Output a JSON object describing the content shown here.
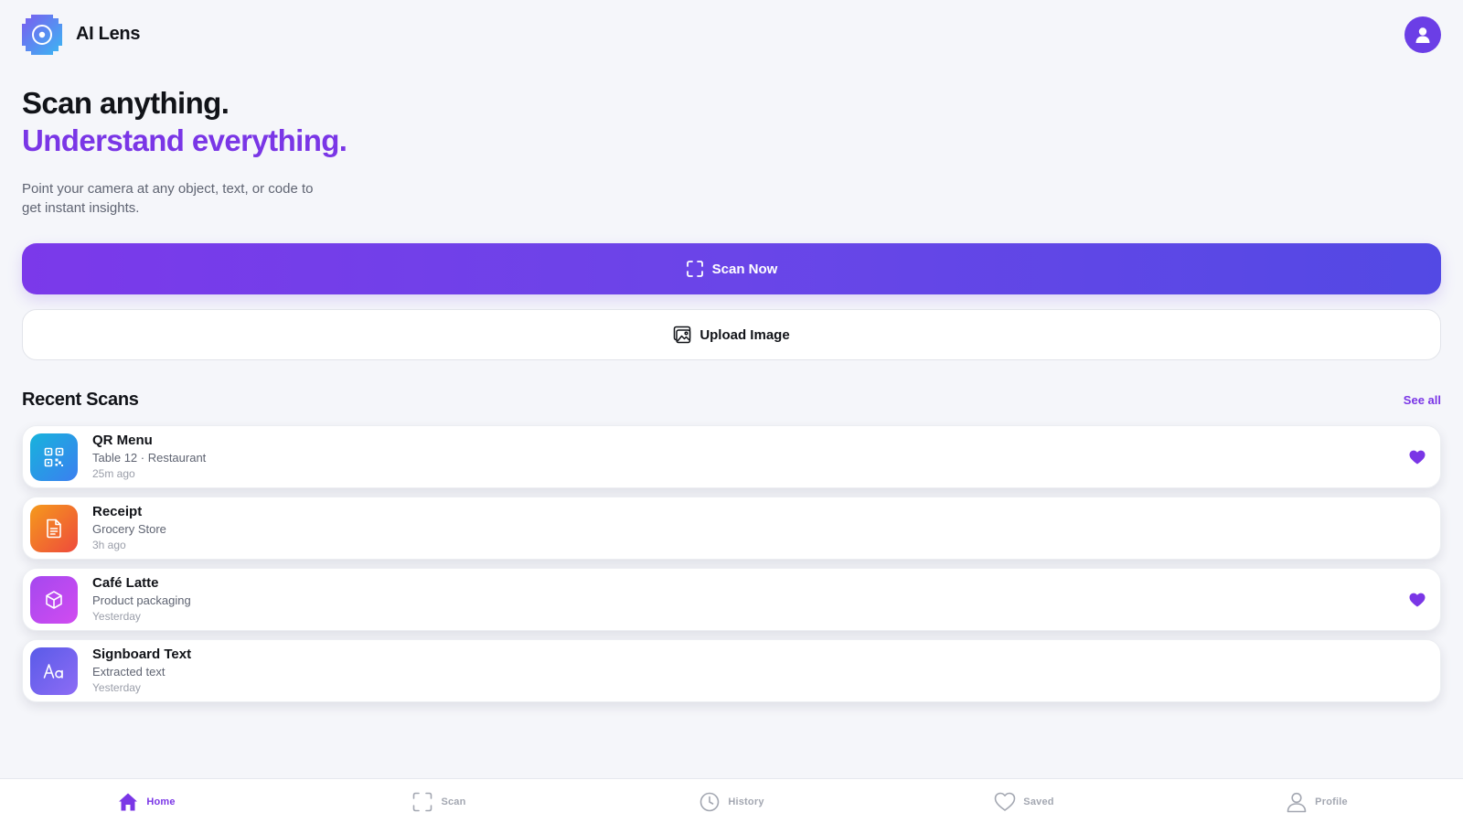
{
  "app": {
    "name": "AI Lens"
  },
  "colors": {
    "accent": "#7a36e6",
    "background": "#f5f6fa",
    "gradient_start": "#7b39ea",
    "gradient_end": "#5349e4"
  },
  "hero": {
    "headline": "Scan anything.",
    "headline_accent": "Understand everything.",
    "description": "Point your camera at any object, text, or code to get instant insights."
  },
  "actions": {
    "scan_label": "Scan Now",
    "scan_icon": "scan-frame-icon",
    "upload_label": "Upload Image",
    "upload_icon": "image-icon"
  },
  "recent": {
    "title": "Recent Scans",
    "see_all_label": "See all",
    "items": [
      {
        "title": "QR Menu",
        "subtitle": "Table 12 · Restaurant",
        "time": "25m ago",
        "icon": "qr-code-icon",
        "favorited": true,
        "color_from": "#17b3dc",
        "color_to": "#3b7ff0"
      },
      {
        "title": "Receipt",
        "subtitle": "Grocery Store",
        "time": "3h ago",
        "icon": "document-icon",
        "favorited": false,
        "color_from": "#f59a1c",
        "color_to": "#ee4a3c"
      },
      {
        "title": "Café Latte",
        "subtitle": "Product packaging",
        "time": "Yesterday",
        "icon": "box-icon",
        "favorited": true,
        "color_from": "#a548ef",
        "color_to": "#d14cf0"
      },
      {
        "title": "Signboard Text",
        "subtitle": "Extracted text",
        "time": "Yesterday",
        "icon": "text-icon",
        "favorited": false,
        "color_from": "#5a5be8",
        "color_to": "#8d6cf5"
      }
    ]
  },
  "nav": {
    "items": [
      {
        "label": "Home",
        "icon": "home-icon",
        "active": true
      },
      {
        "label": "Scan",
        "icon": "scan-frame-icon",
        "active": false
      },
      {
        "label": "History",
        "icon": "clock-icon",
        "active": false
      },
      {
        "label": "Saved",
        "icon": "heart-icon",
        "active": false
      },
      {
        "label": "Profile",
        "icon": "user-icon",
        "active": false
      }
    ]
  }
}
